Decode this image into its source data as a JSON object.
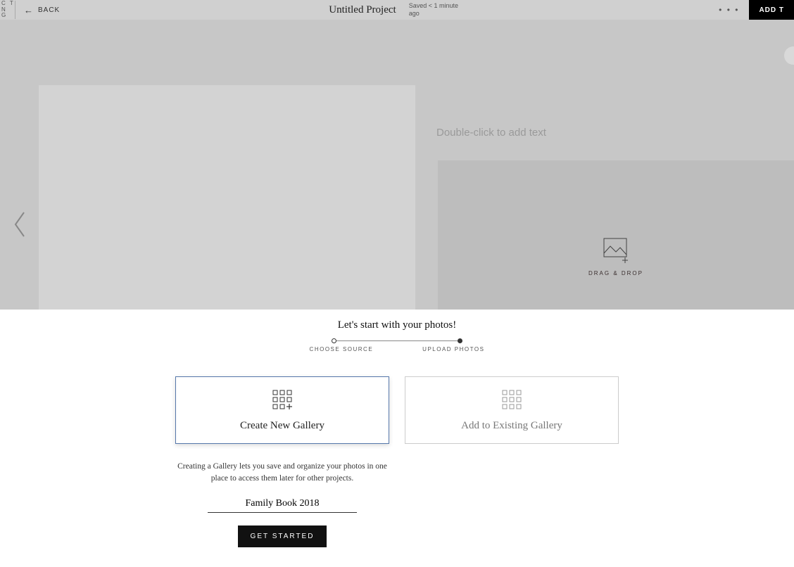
{
  "topbar": {
    "logo_fragment_line1": "C T",
    "logo_fragment_line2": "N G",
    "back_label": "BACK",
    "project_title": "Untitled Project",
    "saved_status": "Saved < 1 minute ago",
    "more_icon": "• • •",
    "add_label": "ADD T"
  },
  "canvas": {
    "text_placeholder": "Double-click to add text",
    "drag_drop_label": "DRAG & DROP"
  },
  "panel": {
    "title": "Let's start with your photos!",
    "step1_label": "CHOOSE SOURCE",
    "step2_label": "UPLOAD PHOTOS",
    "option_new": "Create New Gallery",
    "option_existing": "Add to Existing Gallery",
    "helper_text": "Creating a Gallery lets you save and organize your photos in one place to access them later for other projects.",
    "gallery_name_value": "Family Book 2018",
    "get_started_label": "GET STARTED"
  }
}
